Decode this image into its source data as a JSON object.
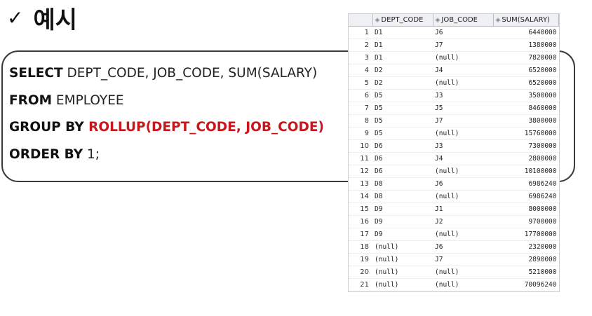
{
  "title": {
    "check": "✓",
    "text": "예시"
  },
  "sql": {
    "line1": {
      "kw": "SELECT",
      "rest": " DEPT_CODE, JOB_CODE, SUM(SALARY)"
    },
    "line2": {
      "kw": "FROM",
      "rest": " EMPLOYEE"
    },
    "line3": {
      "kw": "GROUP BY",
      "red": " ROLLUP(DEPT_CODE, JOB_CODE)"
    },
    "line4": {
      "kw": "ORDER BY",
      "rest": " 1;"
    }
  },
  "grid": {
    "header_icon": "◈",
    "columns": [
      "DEPT_CODE",
      "JOB_CODE",
      "SUM(SALARY)"
    ],
    "rows": [
      [
        "1",
        "D1",
        "J6",
        "6440000"
      ],
      [
        "2",
        "D1",
        "J7",
        "1380000"
      ],
      [
        "3",
        "D1",
        "(null)",
        "7820000"
      ],
      [
        "4",
        "D2",
        "J4",
        "6520000"
      ],
      [
        "5",
        "D2",
        "(null)",
        "6520000"
      ],
      [
        "6",
        "D5",
        "J3",
        "3500000"
      ],
      [
        "7",
        "D5",
        "J5",
        "8460000"
      ],
      [
        "8",
        "D5",
        "J7",
        "3800000"
      ],
      [
        "9",
        "D5",
        "(null)",
        "15760000"
      ],
      [
        "10",
        "D6",
        "J3",
        "7300000"
      ],
      [
        "11",
        "D6",
        "J4",
        "2800000"
      ],
      [
        "12",
        "D6",
        "(null)",
        "10100000"
      ],
      [
        "13",
        "D8",
        "J6",
        "6986240"
      ],
      [
        "14",
        "D8",
        "(null)",
        "6986240"
      ],
      [
        "15",
        "D9",
        "J1",
        "8000000"
      ],
      [
        "16",
        "D9",
        "J2",
        "9700000"
      ],
      [
        "17",
        "D9",
        "(null)",
        "17700000"
      ],
      [
        "18",
        "(null)",
        "J6",
        "2320000"
      ],
      [
        "19",
        "(null)",
        "J7",
        "2890000"
      ],
      [
        "20",
        "(null)",
        "(null)",
        "5210000"
      ],
      [
        "21",
        "(null)",
        "(null)",
        "70096240"
      ]
    ]
  }
}
